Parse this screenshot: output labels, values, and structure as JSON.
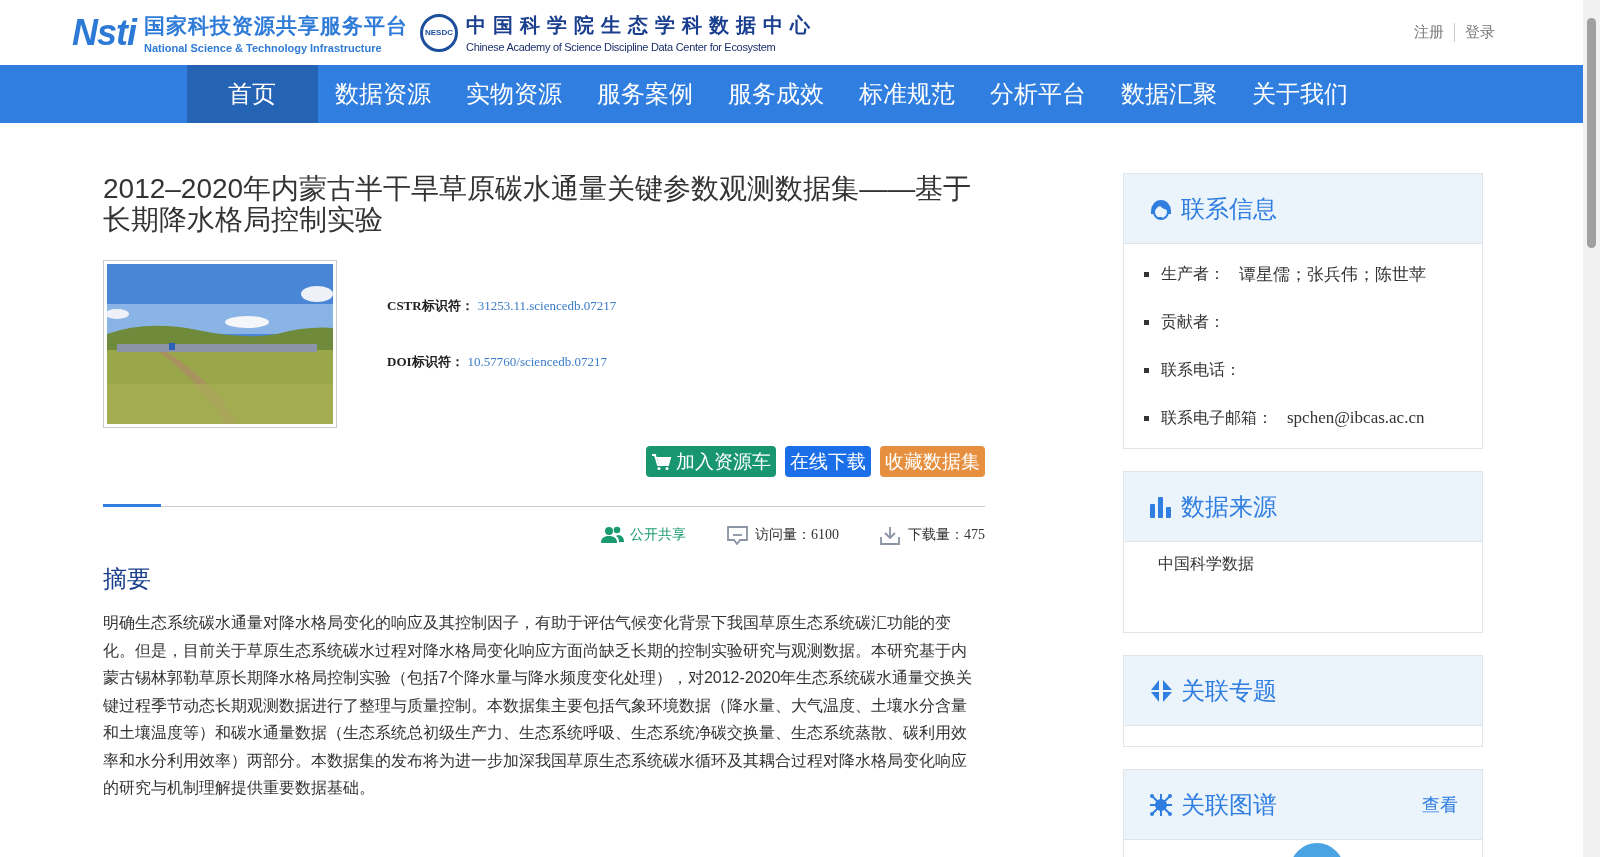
{
  "header": {
    "platform": {
      "mark": "Nsti",
      "name": "国家科技资源共享服务平台",
      "name_en": "National Science & Technology Infrastructure"
    },
    "center": {
      "mark": "NESDC",
      "name": "中国科学院生态学科数据中心",
      "name_en": "Chinese Academy of Science Discipline Data Center for Ecosystem"
    },
    "links": [
      {
        "label": "注册"
      },
      {
        "label": "登录"
      }
    ]
  },
  "nav": [
    {
      "label": "首页",
      "selected": true
    },
    {
      "label": "数据资源",
      "selected": false
    },
    {
      "label": "实物资源",
      "selected": false
    },
    {
      "label": "服务案例",
      "selected": false
    },
    {
      "label": "服务成效",
      "selected": false
    },
    {
      "label": "标准规范",
      "selected": false
    },
    {
      "label": "分析平台",
      "selected": false
    },
    {
      "label": "数据汇聚",
      "selected": false
    },
    {
      "label": "关于我们",
      "selected": false
    }
  ],
  "dataset": {
    "title": "2012–2020年内蒙古半干旱草原碳水通量关键参数观测数据集——基于长期降水格局控制实验",
    "identifiers": [
      {
        "label": "CSTR标识符：",
        "value": "31253.11.sciencedb.07217"
      },
      {
        "label": "DOI标识符：",
        "value": "10.57760/sciencedb.07217"
      }
    ],
    "buttons": [
      {
        "kind": "cart",
        "label": "加入资源车"
      },
      {
        "kind": "download",
        "label": "在线下载"
      },
      {
        "kind": "favorite",
        "label": "收藏数据集"
      }
    ],
    "stats": [
      {
        "kind": "access",
        "text": "公开共享"
      },
      {
        "kind": "visits",
        "text": "访问量：6100"
      },
      {
        "kind": "downloads",
        "text": "下载量：475"
      }
    ],
    "abstract": {
      "heading": "摘要",
      "text": "明确生态系统碳水通量对降水格局变化的响应及其控制因子，有助于评估气候变化背景下我国草原生态系统碳汇功能的变化。但是，目前关于草原生态系统碳水过程对降水格局变化响应方面尚缺乏长期的控制实验研究与观测数据。本研究基于内蒙古锡林郭勒草原长期降水格局控制实验（包括7个降水量与降水频度变化处理），对2012-2020年生态系统碳水通量交换关键过程季节动态长期观测数据进行了整理与质量控制。本数据集主要包括气象环境数据（降水量、大气温度、土壤水分含量和土壤温度等）和碳水通量数据（生态系统总初级生产力、生态系统呼吸、生态系统净碳交换量、生态系统蒸散、碳利用效率和水分利用效率）两部分。本数据集的发布将为进一步加深我国草原生态系统碳水循环及其耦合过程对降水格局变化响应的研究与机制理解提供重要数据基础。"
    }
  },
  "sidebar": [
    {
      "kind": "contact",
      "title": "联系信息",
      "items": [
        {
          "label": "生产者：",
          "value": "谭星儒；张兵伟；陈世苹"
        },
        {
          "label": "贡献者："
        },
        {
          "label": "联系电话："
        },
        {
          "label": "联系电子邮箱：",
          "value": "spchen@ibcas.ac.cn"
        }
      ]
    },
    {
      "kind": "source",
      "title": "数据来源",
      "text": "中国科学数据"
    },
    {
      "kind": "topic",
      "title": "关联专题"
    },
    {
      "kind": "graph",
      "title": "关联图谱",
      "link": "查看"
    }
  ]
}
